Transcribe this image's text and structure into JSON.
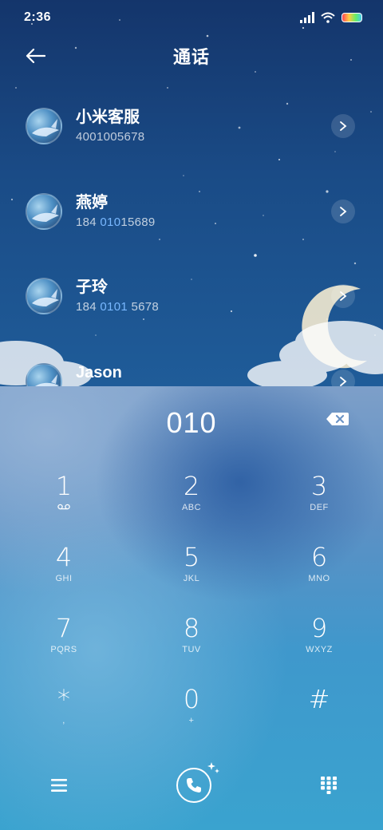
{
  "status_bar": {
    "time": "2:36"
  },
  "header": {
    "title": "通话"
  },
  "contacts": [
    {
      "name": "小米客服",
      "number_pre": "400",
      "number_hl": "1005678",
      "number_post": "",
      "hl_style": "none"
    },
    {
      "name": "燕婷",
      "number_pre": "184 ",
      "number_hl": "010",
      "number_post": "15689"
    },
    {
      "name": "子玲",
      "number_pre": "184 ",
      "number_hl": "0101",
      "number_post": " 5678"
    },
    {
      "name": "Jason",
      "number_pre": "",
      "number_hl": "",
      "number_post": ""
    }
  ],
  "dialer": {
    "display": "010",
    "keys": [
      {
        "digit": "1",
        "sub": ""
      },
      {
        "digit": "2",
        "sub": "ABC"
      },
      {
        "digit": "3",
        "sub": "DEF"
      },
      {
        "digit": "4",
        "sub": "GHI"
      },
      {
        "digit": "5",
        "sub": "JKL"
      },
      {
        "digit": "6",
        "sub": "MNO"
      },
      {
        "digit": "7",
        "sub": "PQRS"
      },
      {
        "digit": "8",
        "sub": "TUV"
      },
      {
        "digit": "9",
        "sub": "WXYZ"
      },
      {
        "digit": "*",
        "sub": ","
      },
      {
        "digit": "0",
        "sub": "+"
      },
      {
        "digit": "#",
        "sub": ""
      }
    ]
  },
  "icons": {
    "back": "arrow-left-icon",
    "backspace": "backspace-icon",
    "menu": "menu-icon",
    "call": "phone-icon",
    "keypad": "keypad-icon"
  }
}
